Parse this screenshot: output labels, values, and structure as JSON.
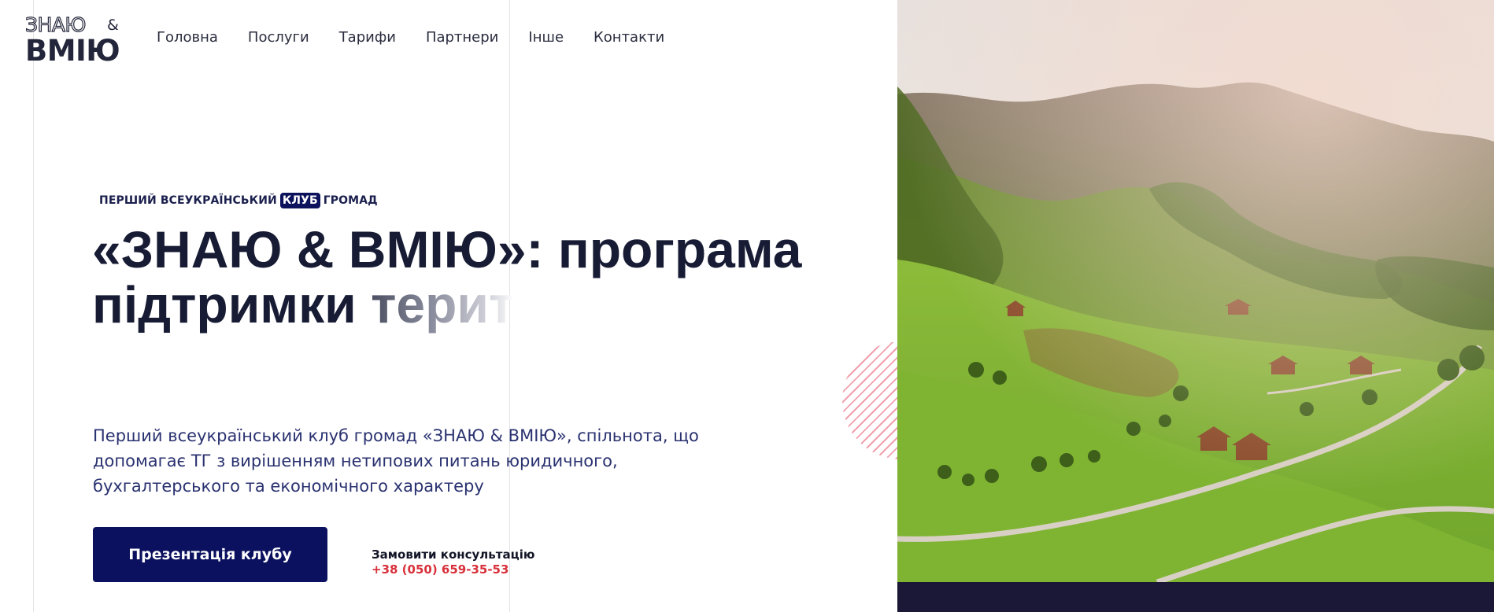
{
  "header": {
    "logo": {
      "line1": "ЗНАЮ",
      "amp": "&",
      "line2": "ВМІЮ"
    },
    "nav": [
      "Головна",
      "Послуги",
      "Тарифи",
      "Партнери",
      "Інше",
      "Контакти"
    ]
  },
  "hero": {
    "eyebrow": {
      "before": "Перший всеукраїнський",
      "highlight": "клуб",
      "after": "громад"
    },
    "title_main": "«ЗНАЮ & ВМІЮ»: програма підтримки ",
    "title_fading": "терит",
    "description": "Перший всеукраїнський клуб громад «ЗНАЮ & ВМІЮ», спільнота, що допомагає ТГ з вирішенням нетипових питань юридичного, бухгалтерського та економічного характеру",
    "cta_label": "Презентація клубу",
    "consult_label": "Замовити консультацію",
    "consult_phone": "+38 (050) 659-35-53"
  },
  "colors": {
    "primary": "#0b115e",
    "title": "#171c34",
    "text": "#2a3270",
    "accent_phone": "#d8313b",
    "footer_bar": "#1a1836"
  }
}
